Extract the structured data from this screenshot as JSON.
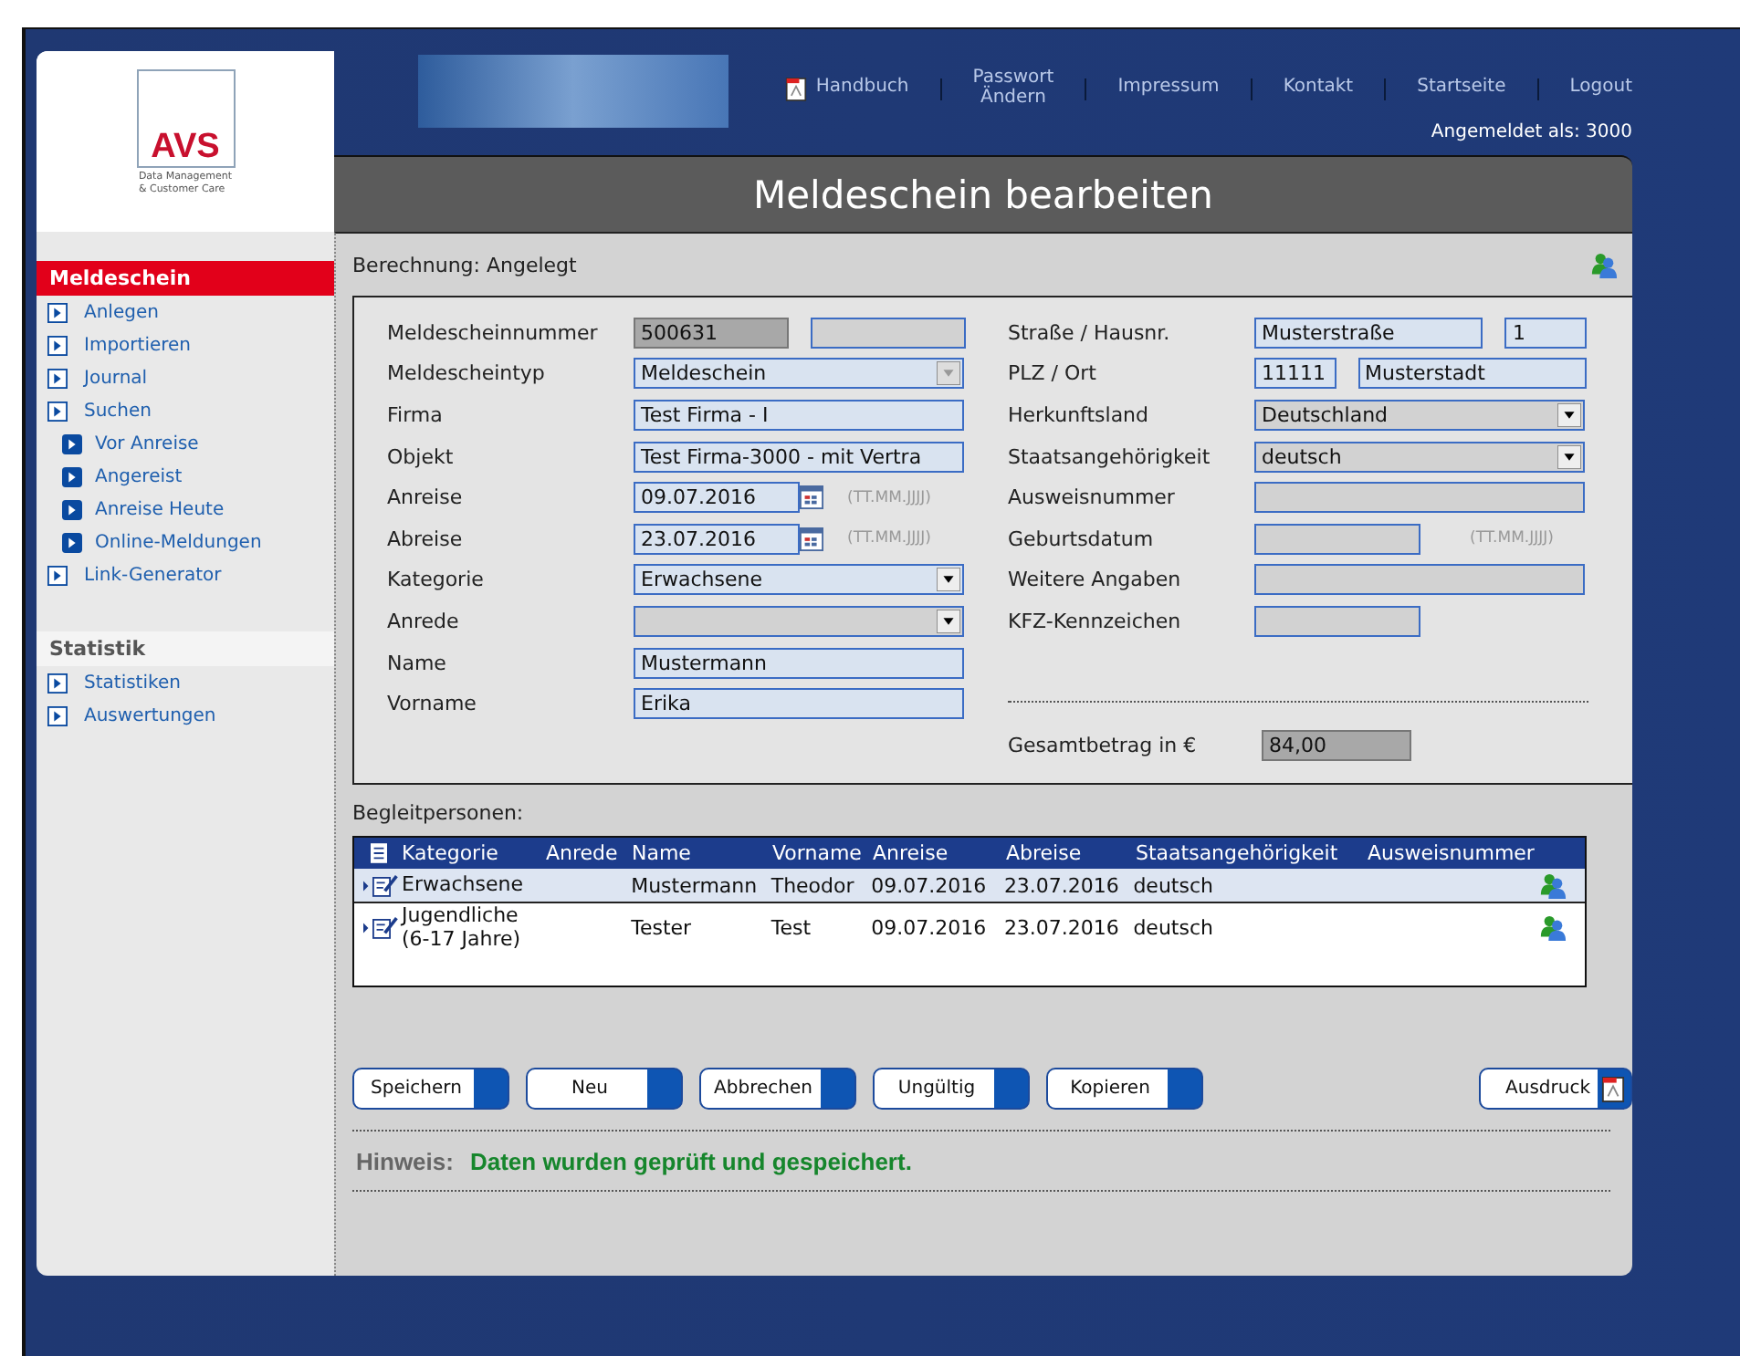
{
  "header": {
    "links": [
      {
        "label": "Handbuch",
        "kind": "pdf"
      },
      {
        "label": "Passwort\nÄndern",
        "kind": "plain"
      },
      {
        "label": "Impressum",
        "kind": "plain"
      },
      {
        "label": "Kontakt",
        "kind": "plain"
      },
      {
        "label": "Startseite",
        "kind": "plain"
      },
      {
        "label": "Logout",
        "kind": "plain"
      }
    ],
    "login": "Angemeldet als: 3000"
  },
  "logo": {
    "mark": "AVS",
    "tagline": "Data Management\n& Customer Care"
  },
  "sidebar": {
    "sections": [
      {
        "title": "Meldeschein",
        "selected": true,
        "items": [
          {
            "label": "Anlegen"
          },
          {
            "label": "Importieren"
          },
          {
            "label": "Journal"
          },
          {
            "label": "Suchen",
            "children": [
              {
                "label": "Vor Anreise"
              },
              {
                "label": "Angereist"
              },
              {
                "label": "Anreise Heute"
              },
              {
                "label": "Online-Meldungen"
              }
            ]
          },
          {
            "label": "Link-Generator"
          }
        ]
      },
      {
        "title": "Statistik",
        "selected": false,
        "items": [
          {
            "label": "Statistiken"
          },
          {
            "label": "Auswertungen"
          }
        ]
      }
    ]
  },
  "page_title": "Meldeschein bearbeiten",
  "status_line": "Berechnung: Angelegt",
  "form": {
    "left": [
      {
        "label": "Meldescheinnummer",
        "kind": "split-even",
        "inputs": [
          {
            "value": "500631",
            "disabled": true
          },
          {
            "disabled": true
          }
        ]
      },
      {
        "label": "Meldescheintyp",
        "kind": "select",
        "inputs": [
          {
            "value": "Meldeschein",
            "disabled": false,
            "locked": true
          }
        ]
      },
      {
        "label": "Firma",
        "kind": "text",
        "inputs": [
          {
            "value": "Test Firma - I",
            "disabled": false
          }
        ]
      },
      {
        "label": "Objekt",
        "kind": "text",
        "inputs": [
          {
            "value": "Test Firma-3000 - mit Vertra",
            "disabled": false
          }
        ]
      },
      {
        "label": "Anreise",
        "kind": "date",
        "inputs": [
          {
            "value": "09.07.2016",
            "disabled": false
          }
        ],
        "hint": "(TT.MM.JJJJ)"
      },
      {
        "label": "Abreise",
        "kind": "date",
        "inputs": [
          {
            "value": "23.07.2016",
            "disabled": false
          }
        ],
        "hint": "(TT.MM.JJJJ)"
      },
      {
        "label": "Kategorie",
        "kind": "select",
        "inputs": [
          {
            "value": "Erwachsene",
            "disabled": false,
            "locked": false
          }
        ]
      },
      {
        "label": "Anrede",
        "kind": "select",
        "inputs": [
          {
            "disabled": true,
            "locked": false
          }
        ]
      },
      {
        "label": "Name",
        "kind": "text",
        "inputs": [
          {
            "value": "Mustermann",
            "disabled": false
          }
        ]
      },
      {
        "label": "Vorname",
        "kind": "text",
        "inputs": [
          {
            "value": "Erika",
            "disabled": false
          }
        ]
      }
    ],
    "right": [
      {
        "label": "Straße / Hausnr.",
        "kind": "split",
        "inputs": [
          {
            "value": "Musterstraße",
            "disabled": false
          },
          {
            "value": "1",
            "disabled": false
          }
        ]
      },
      {
        "label": "PLZ / Ort",
        "kind": "split-rev",
        "inputs": [
          {
            "value": "11111",
            "disabled": false
          },
          {
            "value": "Musterstadt",
            "disabled": false
          }
        ]
      },
      {
        "label": "Herkunftsland",
        "kind": "select",
        "inputs": [
          {
            "value": "Deutschland",
            "disabled": true,
            "locked": false
          }
        ]
      },
      {
        "label": "Staatsangehörigkeit",
        "kind": "select",
        "inputs": [
          {
            "value": "deutsch",
            "disabled": true,
            "locked": false
          }
        ]
      },
      {
        "label": "Ausweisnummer",
        "kind": "text",
        "inputs": [
          {
            "disabled": true
          }
        ]
      },
      {
        "label": "Geburtsdatum",
        "kind": "short",
        "inputs": [
          {
            "disabled": true
          }
        ],
        "hint": "(TT.MM.JJJJ)"
      },
      {
        "label": "Weitere Angaben",
        "kind": "text",
        "inputs": [
          {
            "disabled": true
          }
        ]
      },
      {
        "label": "KFZ-Kennzeichen",
        "kind": "short",
        "inputs": [
          {
            "disabled": true
          }
        ]
      }
    ],
    "total": {
      "label": "Gesamtbetrag in €",
      "value": "84,00"
    }
  },
  "companions": {
    "title": "Begleitpersonen:",
    "columns": [
      "Kategorie",
      "Anrede",
      "Name",
      "Vorname",
      "Anreise",
      "Abreise",
      "Staatsangehörigkeit",
      "Ausweisnummer"
    ],
    "rows": [
      {
        "selected": true,
        "cells": [
          "Erwachsene",
          null,
          "Mustermann",
          "Theodor",
          "09.07.2016",
          "23.07.2016",
          "deutsch",
          null
        ]
      },
      {
        "selected": false,
        "cells": [
          "Jugendliche (6-17 Jahre)",
          null,
          "Tester",
          "Test",
          "09.07.2016",
          "23.07.2016",
          "deutsch",
          null
        ]
      }
    ]
  },
  "buttons": [
    "Speichern",
    "Neu",
    "Abbrechen",
    "Ungültig",
    "Kopieren"
  ],
  "print_button": "Ausdruck",
  "notice": {
    "label": "Hinweis:",
    "message": "Daten wurden geprüft und gespeichert."
  }
}
